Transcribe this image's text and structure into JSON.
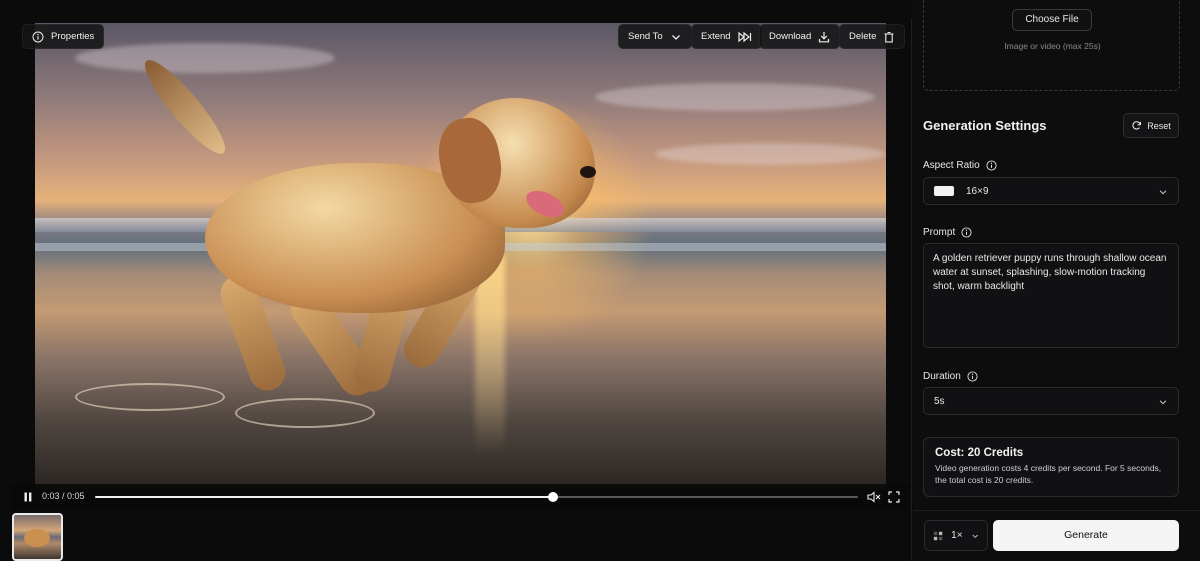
{
  "video_toolbar": {
    "properties_label": "Properties",
    "send_to_label": "Send To",
    "extend_label": "Extend",
    "download_label": "Download",
    "delete_label": "Delete"
  },
  "player": {
    "current_time": "0:03",
    "duration": "0:05",
    "time_display": "0:03 / 0:05",
    "progress": 0.6,
    "playing": true,
    "muted": true
  },
  "upload": {
    "choose_label": "Choose File",
    "hint": "Image or video (max 25s)"
  },
  "settings": {
    "title": "Generation Settings",
    "reset_label": "Reset",
    "aspect_ratio": {
      "label": "Aspect Ratio",
      "value": "16×9"
    },
    "prompt": {
      "label": "Prompt",
      "value": "A golden retriever puppy runs through shallow ocean water at sunset, splashing, slow-motion tracking shot, warm backlight"
    },
    "duration": {
      "label": "Duration",
      "value": "5s"
    },
    "cost": {
      "title": "Cost: 20 Credits",
      "description": "Video generation costs 4 credits per second. For 5 seconds, the total cost is 20 credits."
    },
    "count": {
      "value": "1×"
    },
    "generate_label": "Generate"
  },
  "icons": {
    "properties": "info-icon",
    "send_to": "chevron-down-icon",
    "extend": "fast-forward-icon",
    "download": "download-icon",
    "delete": "trash-icon",
    "reset": "refresh-icon"
  },
  "colors": {
    "background": "#0b0b0c",
    "panel": "#111113",
    "border": "#2b2b2e",
    "text": "#e8e8e8",
    "primary_button": "#f4f4f5"
  }
}
